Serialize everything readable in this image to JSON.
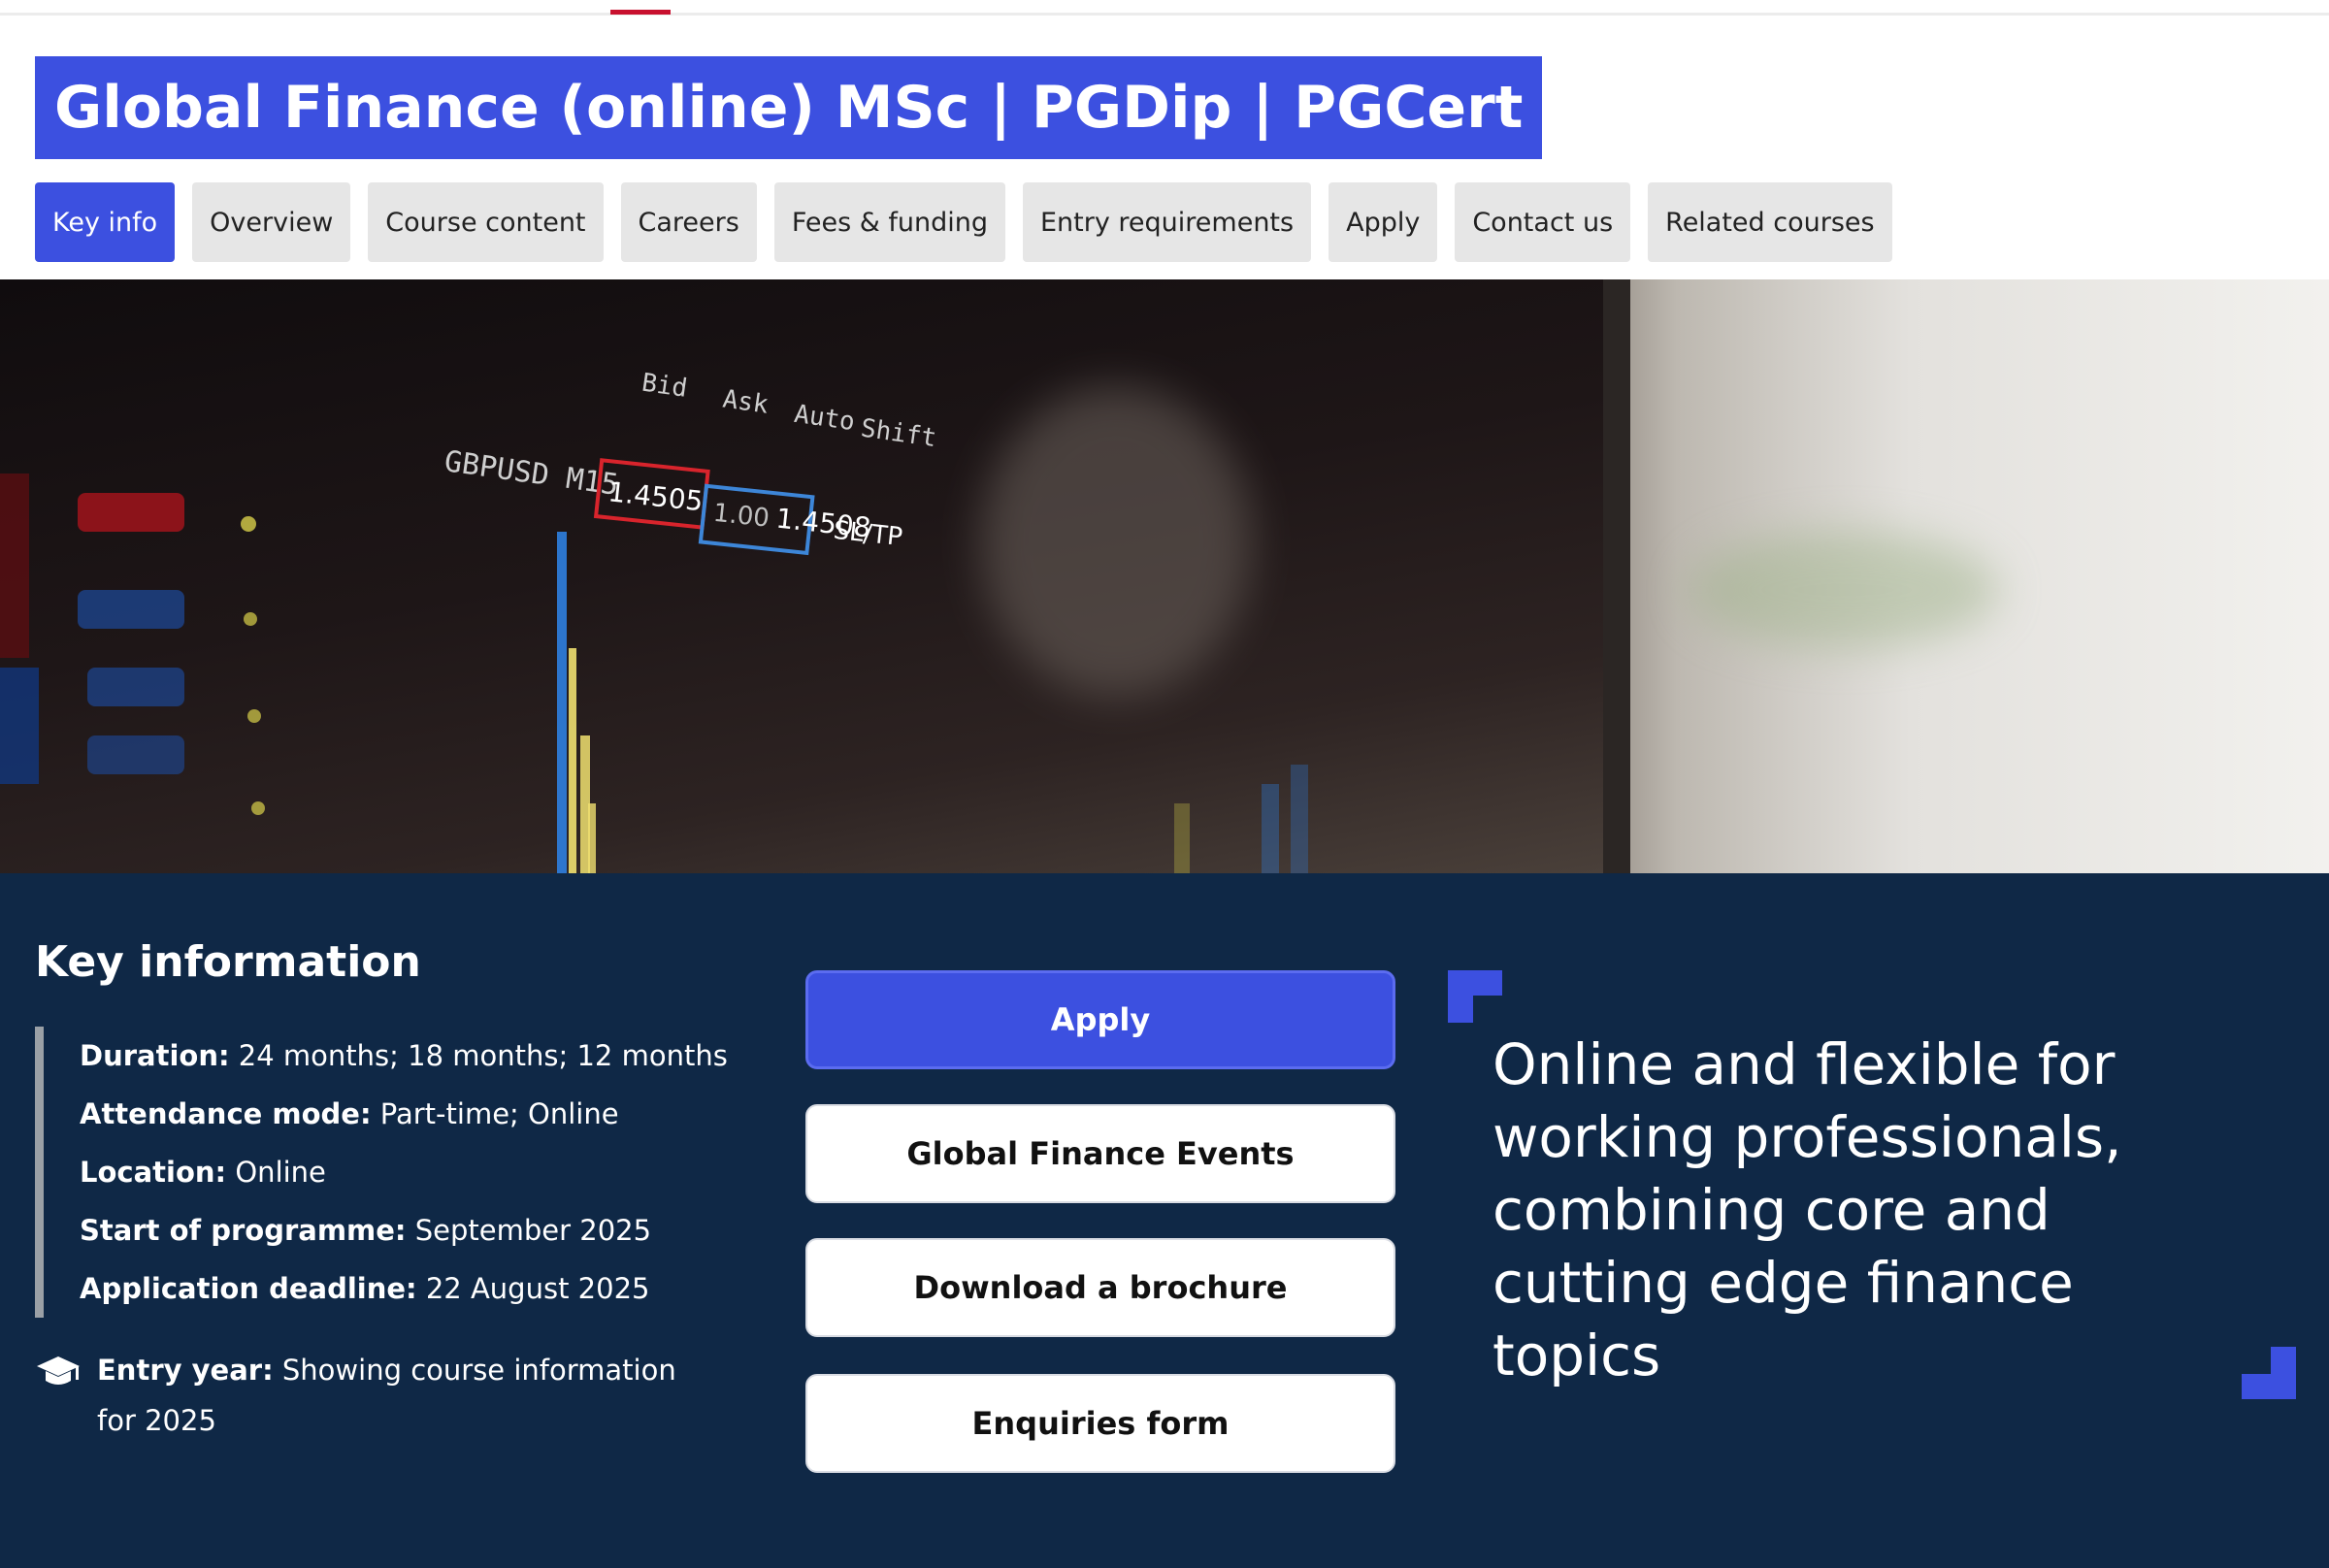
{
  "page": {
    "title": "Global Finance (online) MSc | PGDip | PGCert"
  },
  "tabs": [
    {
      "label": "Key info",
      "active": true
    },
    {
      "label": "Overview"
    },
    {
      "label": "Course content"
    },
    {
      "label": "Careers"
    },
    {
      "label": "Fees & funding"
    },
    {
      "label": "Entry requirements"
    },
    {
      "label": "Apply"
    },
    {
      "label": "Contact us"
    },
    {
      "label": "Related courses"
    }
  ],
  "hero": {
    "image": "trading-screen-photo",
    "screen_text": [
      "Bid",
      "Ask",
      "Auto",
      "Shift",
      "GBPUSD M15",
      "1.4505",
      "1.00",
      "1.4508",
      "SL/TP"
    ]
  },
  "key_information": {
    "heading": "Key information",
    "facts": [
      {
        "label": "Duration:",
        "value": "24 months; 18 months; 12 months"
      },
      {
        "label": "Attendance mode:",
        "value": "Part-time; Online"
      },
      {
        "label": "Location:",
        "value": "Online"
      },
      {
        "label": "Start of programme:",
        "value": "September 2025"
      },
      {
        "label": "Application deadline:",
        "value": "22 August 2025"
      }
    ],
    "entry_year": {
      "icon": "graduation-cap-icon",
      "label": "Entry year:",
      "value": "Showing course information for 2025"
    }
  },
  "actions": {
    "apply": "Apply",
    "events": "Global Finance Events",
    "brochure": "Download a brochure",
    "enquiries": "Enquiries form"
  },
  "quote": {
    "text": "Online and flexible for working professionals, combining core and cutting edge finance topics"
  },
  "colors": {
    "accent": "#3c50e0",
    "navy": "#0f2846",
    "tab_bg": "#e6e6e6",
    "top_indicator": "#c8102e"
  }
}
